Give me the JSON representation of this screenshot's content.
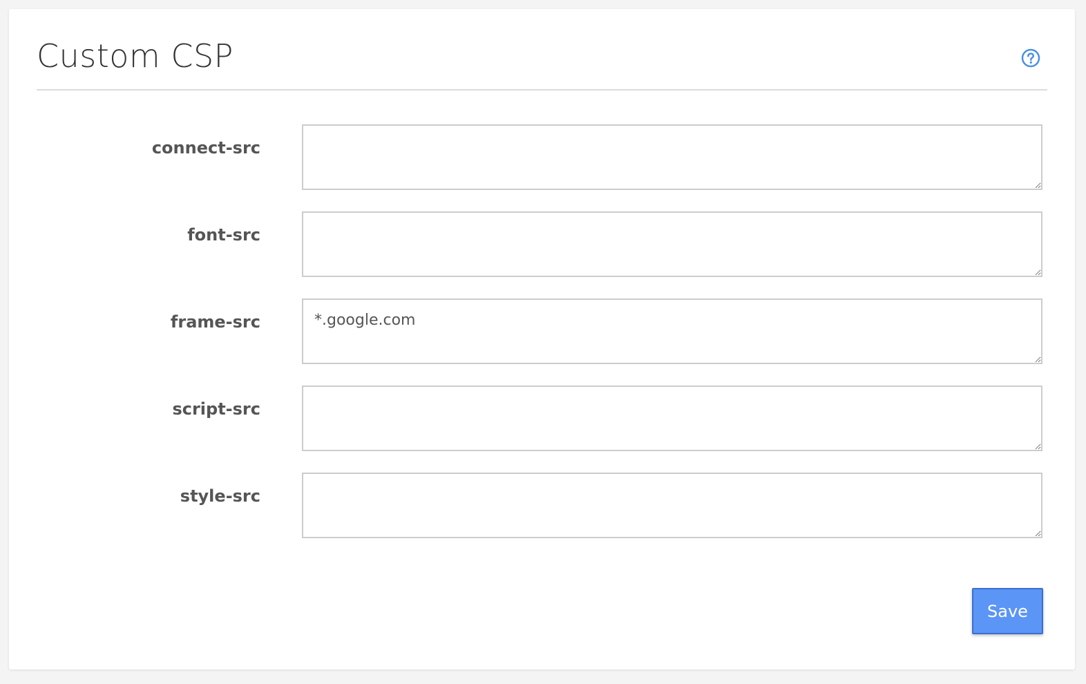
{
  "panel": {
    "title": "Custom CSP",
    "help_icon": "question-circle-icon",
    "accent_color": "#5b95f5"
  },
  "fields": [
    {
      "label": "connect-src",
      "value": ""
    },
    {
      "label": "font-src",
      "value": ""
    },
    {
      "label": "frame-src",
      "value": "*.google.com"
    },
    {
      "label": "script-src",
      "value": ""
    },
    {
      "label": "style-src",
      "value": ""
    }
  ],
  "actions": {
    "save_label": "Save"
  }
}
